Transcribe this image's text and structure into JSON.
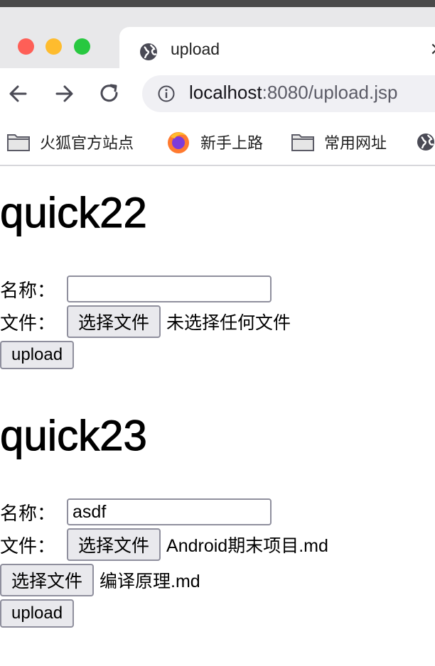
{
  "browser": {
    "tab_title": "upload",
    "tab_close": "×",
    "url_host": "localhost",
    "url_rest": ":8080/upload.jsp",
    "bookmarks": [
      {
        "label": "火狐官方站点",
        "icon": "folder-icon"
      },
      {
        "label": "新手上路",
        "icon": "firefox-icon"
      },
      {
        "label": "常用网址",
        "icon": "folder-icon"
      },
      {
        "label": "",
        "icon": "globe-icon"
      }
    ]
  },
  "form1": {
    "title": "quick22",
    "name_label": "名称：",
    "name_value": "",
    "file_label": "文件：",
    "file_button": "选择文件",
    "file_status": "未选择任何文件",
    "submit": "upload"
  },
  "form2": {
    "title": "quick23",
    "name_label": "名称：",
    "name_value": "asdf",
    "file_label": "文件：",
    "file_button": "选择文件",
    "file_status": "Android期末项目.md",
    "file2_button": "选择文件",
    "file2_status": "编译原理.md",
    "submit": "upload"
  }
}
